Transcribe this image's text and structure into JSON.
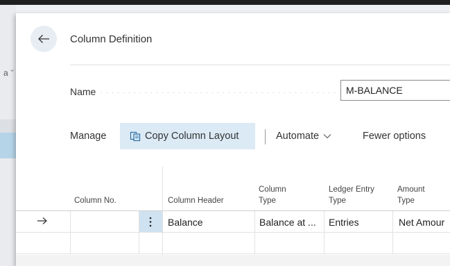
{
  "left_strip": {
    "letter": "a"
  },
  "header": {
    "title": "Column Definition"
  },
  "name_field": {
    "label": "Name",
    "value": "M-BALANCE"
  },
  "actions": {
    "manage": "Manage",
    "copy_layout": "Copy Column Layout",
    "automate": "Automate",
    "fewer_options": "Fewer options"
  },
  "table": {
    "headers": {
      "column_no": "Column No.",
      "column_header": "Column Header",
      "column_type_1": "Column",
      "column_type_2": "Type",
      "ledger_entry_type_1": "Ledger Entry",
      "ledger_entry_type_2": "Type",
      "amount_type_1": "Amount",
      "amount_type_2": "Type"
    },
    "rows": [
      {
        "column_no": "",
        "column_header": "Balance",
        "column_type": "Balance at ...",
        "ledger_entry_type": "Entries",
        "amount_type": "Net Amour"
      }
    ]
  },
  "colors": {
    "accent": "#dbeaf5",
    "selected_cell": "#cfe2f1"
  },
  "icons": {
    "back": "arrow-left-icon",
    "copy": "copy-layout-icon",
    "row_pointer": "arrow-right-icon",
    "row_menu": "vertical-ellipsis-icon",
    "dropdown": "chevron-down-icon"
  }
}
